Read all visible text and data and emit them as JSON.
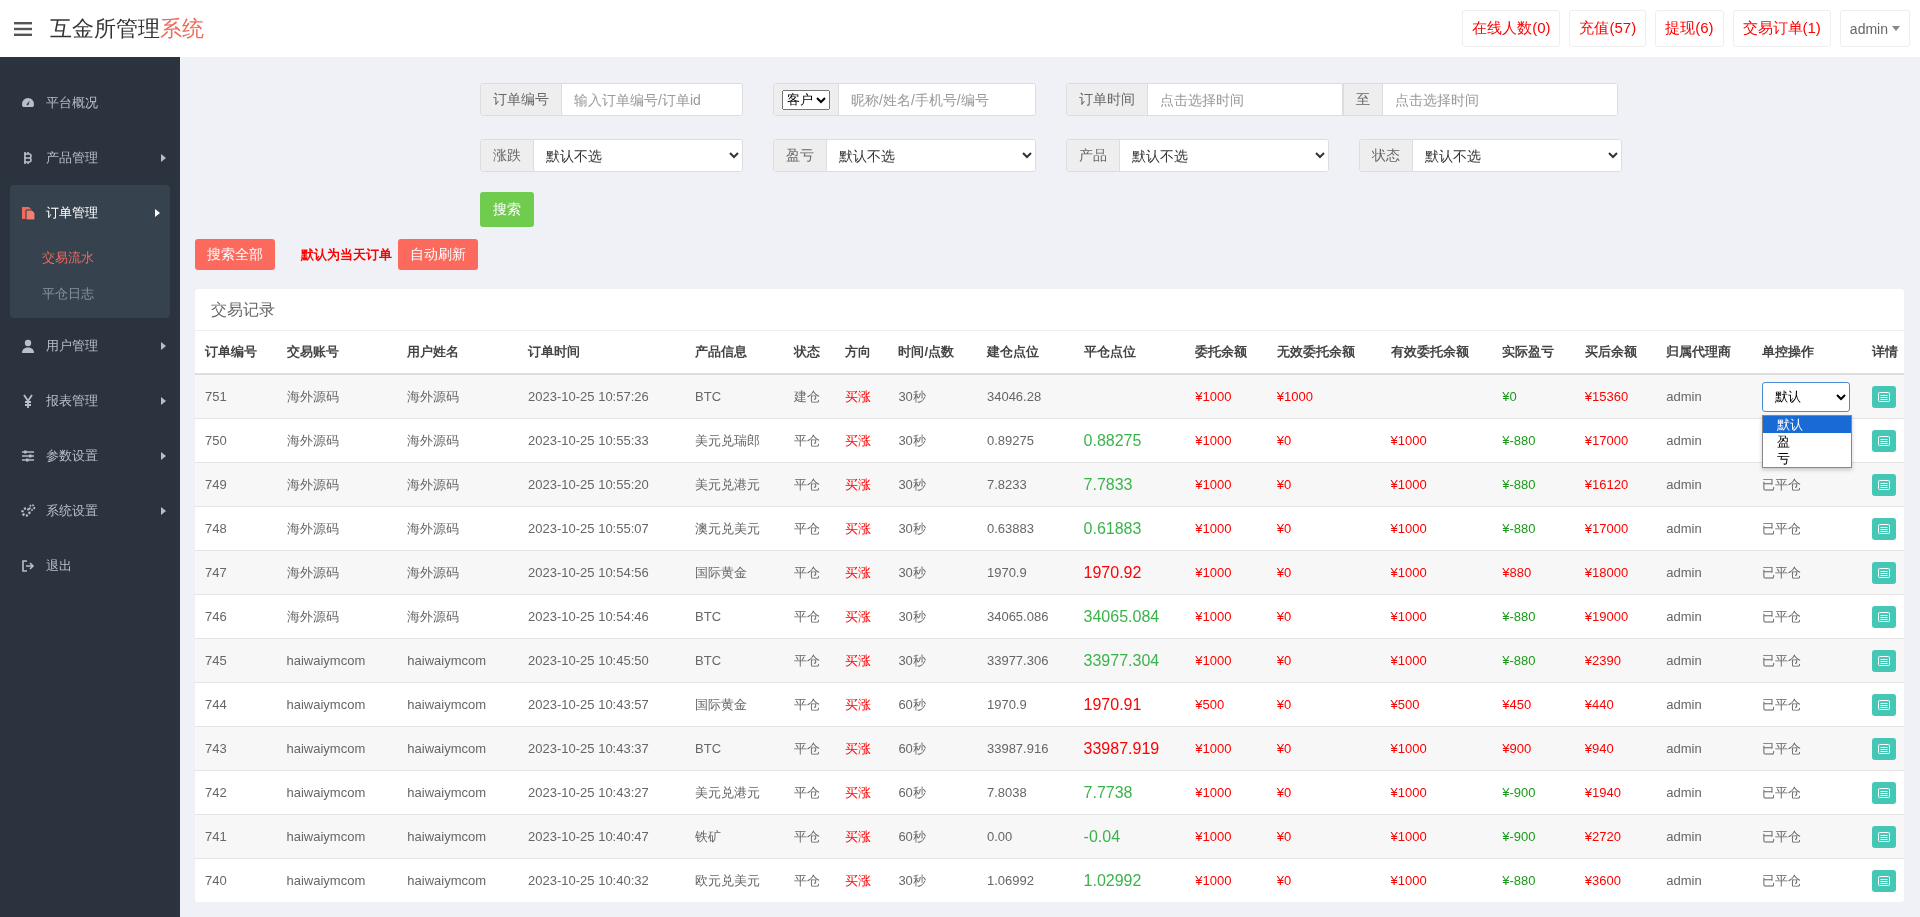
{
  "header": {
    "title_main": "互金所管理",
    "title_accent": "系统",
    "buttons": [
      {
        "label": "在线人数(0)"
      },
      {
        "label": "充值(57)"
      },
      {
        "label": "提现(6)"
      },
      {
        "label": "交易订单(1)"
      }
    ],
    "user": {
      "label": "admin"
    }
  },
  "sidebar": {
    "items": [
      {
        "label": "平台概况",
        "submenu": false,
        "expanded": false
      },
      {
        "label": "产品管理",
        "submenu": true,
        "expanded": false
      },
      {
        "label": "订单管理",
        "submenu": true,
        "expanded": true,
        "children": [
          {
            "label": "交易流水",
            "selected": true
          },
          {
            "label": "平仓日志",
            "selected": false
          }
        ]
      },
      {
        "label": "用户管理",
        "submenu": true,
        "expanded": false
      },
      {
        "label": "报表管理",
        "submenu": true,
        "expanded": false
      },
      {
        "label": "参数设置",
        "submenu": true,
        "expanded": false
      },
      {
        "label": "系统设置",
        "submenu": true,
        "expanded": false
      },
      {
        "label": "退出",
        "submenu": false,
        "expanded": false
      }
    ]
  },
  "filters": {
    "rows": [
      [
        {
          "kind": "input",
          "label": "订单编号",
          "placeholder": "输入订单编号/订单id"
        },
        {
          "kind": "select-input",
          "select_value": "客户",
          "placeholder": "昵称/姓名/手机号/编号"
        },
        {
          "kind": "range",
          "label": "订单时间",
          "separator": "至",
          "placeholder_from": "点击选择时间",
          "placeholder_to": "点击选择时间"
        }
      ],
      [
        {
          "kind": "select",
          "label": "涨跌",
          "value": "默认不选"
        },
        {
          "kind": "select",
          "label": "盈亏",
          "value": "默认不选"
        },
        {
          "kind": "select",
          "label": "产品",
          "value": "默认不选"
        },
        {
          "kind": "select",
          "label": "状态",
          "value": "默认不选"
        }
      ]
    ],
    "search_button": "搜索"
  },
  "actions": {
    "search_all": "搜索全部",
    "note": "默认为当天订单",
    "auto_refresh": "自动刷新"
  },
  "table": {
    "title": "交易记录",
    "columns": [
      "订单编号",
      "交易账号",
      "用户姓名",
      "订单时间",
      "产品信息",
      "状态",
      "方向",
      "时间/点数",
      "建仓点位",
      "平仓点位",
      "委托余额",
      "无效委托余额",
      "有效委托余额",
      "实际盈亏",
      "买后余额",
      "归属代理商",
      "单控操作",
      "详情"
    ],
    "rows": [
      {
        "id": "751",
        "account": "海外源码",
        "name": "海外源码",
        "time": "2023-10-25 10:57:26",
        "product": "BTC",
        "status": "建仓",
        "direction": "买涨",
        "period": "30秒",
        "open_price": "34046.28",
        "win": false,
        "amount": "¥1000",
        "invalid_amount": "¥1000",
        "profit": "¥0",
        "balance": "¥15360",
        "agent": "admin",
        "control": {
          "kind": "select",
          "value": "默认",
          "open": true,
          "options": [
            {
              "label": "默认",
              "selected": true
            },
            {
              "label": "盈",
              "selected": false
            },
            {
              "label": "亏",
              "selected": false
            }
          ]
        }
      },
      {
        "id": "750",
        "account": "海外源码",
        "name": "海外源码",
        "time": "2023-10-25 10:55:33",
        "product": "美元兑瑞郎",
        "status": "平仓",
        "direction": "买涨",
        "period": "30秒",
        "open_price": "0.89275",
        "close_price": "0.88275",
        "win": false,
        "amount": "¥1000",
        "invalid_amount": "¥0",
        "valid_amount": "¥1000",
        "profit": "¥-880",
        "balance": "¥17000",
        "agent": "admin"
      },
      {
        "id": "749",
        "account": "海外源码",
        "name": "海外源码",
        "time": "2023-10-25 10:55:20",
        "product": "美元兑港元",
        "status": "平仓",
        "direction": "买涨",
        "period": "30秒",
        "open_price": "7.8233",
        "close_price": "7.7833",
        "win": false,
        "amount": "¥1000",
        "invalid_amount": "¥0",
        "valid_amount": "¥1000",
        "profit": "¥-880",
        "balance": "¥16120",
        "agent": "admin",
        "control": {
          "kind": "text",
          "text": "已平仓"
        }
      },
      {
        "id": "748",
        "account": "海外源码",
        "name": "海外源码",
        "time": "2023-10-25 10:55:07",
        "product": "澳元兑美元",
        "status": "平仓",
        "direction": "买涨",
        "period": "30秒",
        "open_price": "0.63883",
        "close_price": "0.61883",
        "win": false,
        "amount": "¥1000",
        "invalid_amount": "¥0",
        "valid_amount": "¥1000",
        "profit": "¥-880",
        "balance": "¥17000",
        "agent": "admin",
        "control": {
          "kind": "text",
          "text": "已平仓"
        }
      },
      {
        "id": "747",
        "account": "海外源码",
        "name": "海外源码",
        "time": "2023-10-25 10:54:56",
        "product": "国际黄金",
        "status": "平仓",
        "direction": "买涨",
        "period": "30秒",
        "open_price": "1970.9",
        "close_price": "1970.92",
        "win": true,
        "amount": "¥1000",
        "invalid_amount": "¥0",
        "valid_amount": "¥1000",
        "profit": "¥880",
        "balance": "¥18000",
        "agent": "admin",
        "control": {
          "kind": "text",
          "text": "已平仓"
        }
      },
      {
        "id": "746",
        "account": "海外源码",
        "name": "海外源码",
        "time": "2023-10-25 10:54:46",
        "product": "BTC",
        "status": "平仓",
        "direction": "买涨",
        "period": "30秒",
        "open_price": "34065.086",
        "close_price": "34065.084",
        "win": false,
        "amount": "¥1000",
        "invalid_amount": "¥0",
        "valid_amount": "¥1000",
        "profit": "¥-880",
        "balance": "¥19000",
        "agent": "admin",
        "control": {
          "kind": "text",
          "text": "已平仓"
        }
      },
      {
        "id": "745",
        "account": "haiwaiymcom",
        "name": "haiwaiymcom",
        "time": "2023-10-25 10:45:50",
        "product": "BTC",
        "status": "平仓",
        "direction": "买涨",
        "period": "30秒",
        "open_price": "33977.306",
        "close_price": "33977.304",
        "win": false,
        "amount": "¥1000",
        "invalid_amount": "¥0",
        "valid_amount": "¥1000",
        "profit": "¥-880",
        "balance": "¥2390",
        "agent": "admin",
        "control": {
          "kind": "text",
          "text": "已平仓"
        }
      },
      {
        "id": "744",
        "account": "haiwaiymcom",
        "name": "haiwaiymcom",
        "time": "2023-10-25 10:43:57",
        "product": "国际黄金",
        "status": "平仓",
        "direction": "买涨",
        "period": "60秒",
        "open_price": "1970.9",
        "close_price": "1970.91",
        "win": true,
        "amount": "¥500",
        "invalid_amount": "¥0",
        "valid_amount": "¥500",
        "profit": "¥450",
        "balance": "¥440",
        "agent": "admin",
        "control": {
          "kind": "text",
          "text": "已平仓"
        }
      },
      {
        "id": "743",
        "account": "haiwaiymcom",
        "name": "haiwaiymcom",
        "time": "2023-10-25 10:43:37",
        "product": "BTC",
        "status": "平仓",
        "direction": "买涨",
        "period": "60秒",
        "open_price": "33987.916",
        "close_price": "33987.919",
        "win": true,
        "amount": "¥1000",
        "invalid_amount": "¥0",
        "valid_amount": "¥1000",
        "profit": "¥900",
        "balance": "¥940",
        "agent": "admin",
        "control": {
          "kind": "text",
          "text": "已平仓"
        }
      },
      {
        "id": "742",
        "account": "haiwaiymcom",
        "name": "haiwaiymcom",
        "time": "2023-10-25 10:43:27",
        "product": "美元兑港元",
        "status": "平仓",
        "direction": "买涨",
        "period": "60秒",
        "open_price": "7.8038",
        "close_price": "7.7738",
        "win": false,
        "amount": "¥1000",
        "invalid_amount": "¥0",
        "valid_amount": "¥1000",
        "profit": "¥-900",
        "balance": "¥1940",
        "agent": "admin",
        "control": {
          "kind": "text",
          "text": "已平仓"
        }
      },
      {
        "id": "741",
        "account": "haiwaiymcom",
        "name": "haiwaiymcom",
        "time": "2023-10-25 10:40:47",
        "product": "铁矿",
        "status": "平仓",
        "direction": "买涨",
        "period": "60秒",
        "open_price": "0.00",
        "close_price": "-0.04",
        "win": false,
        "amount": "¥1000",
        "invalid_amount": "¥0",
        "valid_amount": "¥1000",
        "profit": "¥-900",
        "balance": "¥2720",
        "agent": "admin",
        "control": {
          "kind": "text",
          "text": "已平仓"
        }
      },
      {
        "id": "740",
        "account": "haiwaiymcom",
        "name": "haiwaiymcom",
        "time": "2023-10-25 10:40:32",
        "product": "欧元兑美元",
        "status": "平仓",
        "direction": "买涨",
        "period": "30秒",
        "open_price": "1.06992",
        "close_price": "1.02992",
        "win": false,
        "amount": "¥1000",
        "invalid_amount": "¥0",
        "valid_amount": "¥1000",
        "profit": "¥-880",
        "balance": "¥3600",
        "agent": "admin",
        "control": {
          "kind": "text",
          "text": "已平仓"
        }
      }
    ]
  }
}
